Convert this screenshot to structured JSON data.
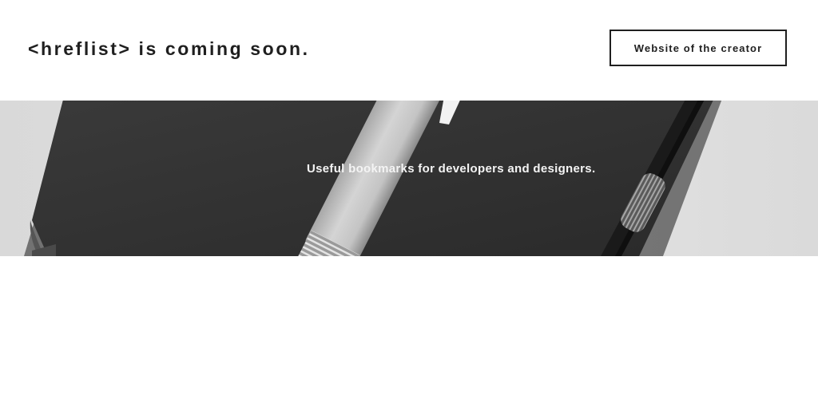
{
  "header": {
    "title": "<hreflist> is coming soon.",
    "creator_button_label": "Website of the creator"
  },
  "hero": {
    "tagline": "Useful bookmarks for developers and designers.",
    "image_description_icon": "notebook-and-pen-photo"
  },
  "colors": {
    "text": "#1f1f1f",
    "background": "#ffffff",
    "hero_overlay_text": "#f4f4f4"
  }
}
